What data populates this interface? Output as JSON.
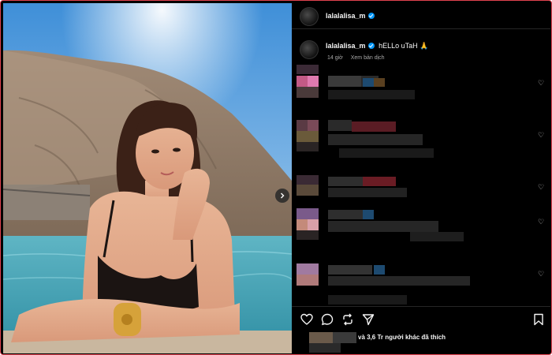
{
  "post": {
    "username": "lalalalisa_m",
    "caption_text": "hELLo uTaH 🙏",
    "time_ago": "14 giờ",
    "translate_label": "Xem bản dịch",
    "likes_text": "và 3,6 Tr người khác đã thích"
  },
  "icons": {
    "verified": "verified-badge-icon",
    "heart": "heart-icon",
    "comment": "comment-icon",
    "share": "share-icon",
    "send": "send-icon",
    "save": "bookmark-icon",
    "next": "chevron-right-icon"
  },
  "colors": {
    "verified": "#0095f6",
    "panel_bg": "#000000",
    "text": "#f5f5f5",
    "muted": "#a8a8a8",
    "frame_border": "#e0424f"
  }
}
